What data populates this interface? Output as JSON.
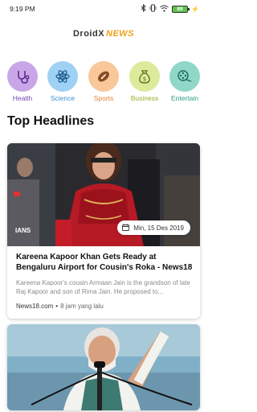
{
  "status": {
    "time": "9:19 PM",
    "battery": "89"
  },
  "app": {
    "name_part1": "DroidX",
    "name_part2": "NEWS"
  },
  "categories": [
    {
      "label": "Health",
      "icon": "stethoscope-icon",
      "bg": "#c9a6e8",
      "label_color": "#7a4bb5"
    },
    {
      "label": "Science",
      "icon": "atom-icon",
      "bg": "#9fd1f5",
      "label_color": "#3b8fd0"
    },
    {
      "label": "Sports",
      "icon": "football-icon",
      "bg": "#f8c89a",
      "label_color": "#e0843a"
    },
    {
      "label": "Business",
      "icon": "money-bag-icon",
      "bg": "#dcea9c",
      "label_color": "#98ad2b"
    },
    {
      "label": "Entertain",
      "icon": "film-reel-icon",
      "bg": "#8fd8c8",
      "label_color": "#2a9c84"
    }
  ],
  "section_title": "Top Headlines",
  "articles": [
    {
      "source_tag": "IANS",
      "date": "Min, 15 Des 2019",
      "headline": "Kareena Kapoor Khan Gets Ready at Bengaluru Airport for Cousin's Roka - News18",
      "summary": "Kareena Kapoor's cousin Armaan Jain is the grandson of late Raj Kapoor and son of Rima Jain. He proposed to...",
      "source": "News18.com",
      "time_ago": "8 jam yang lalu"
    }
  ]
}
